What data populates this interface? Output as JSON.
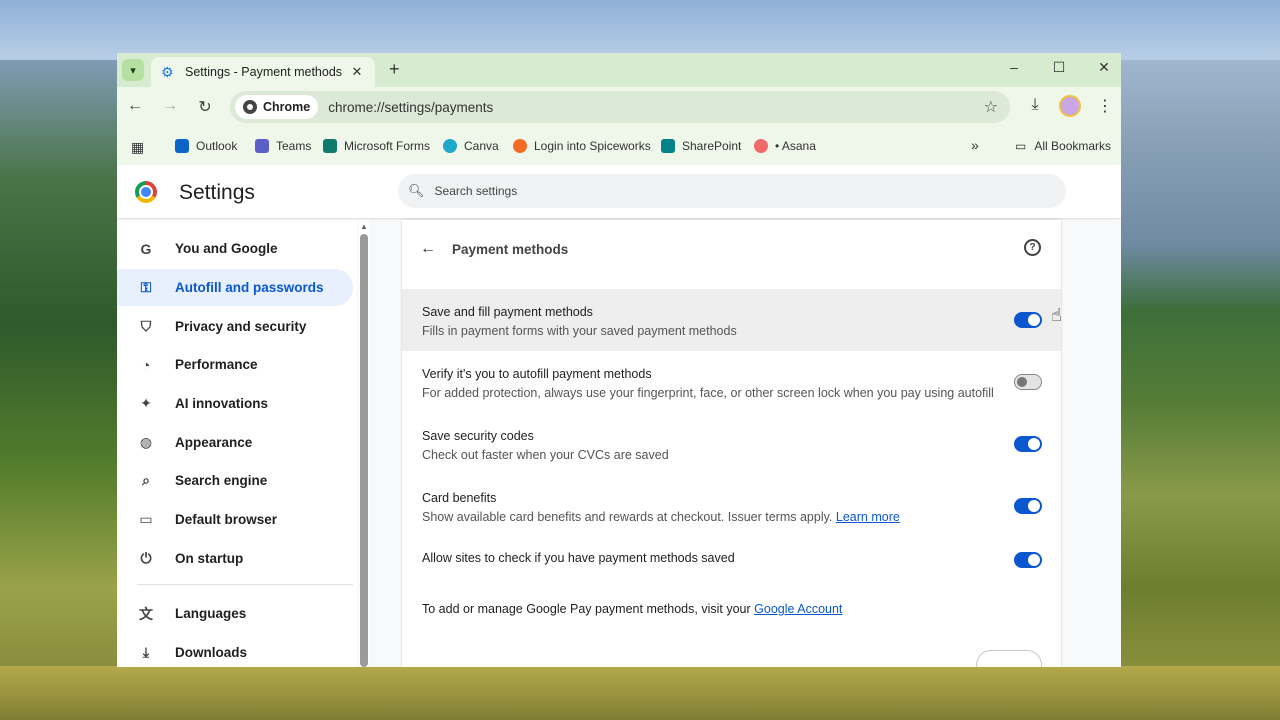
{
  "browser": {
    "tab_title": "Settings - Payment methods",
    "tab_close": "✕",
    "new_tab": "+",
    "minimize": "–",
    "maximize": "☐",
    "close": "✕",
    "chip_label": "Chrome",
    "url": "chrome://settings/payments",
    "bookmarks": [
      "Outlook",
      "Teams",
      "Microsoft Forms",
      "Canva",
      "Login into Spiceworks",
      "SharePoint",
      "• Asana"
    ],
    "all_bookmarks": "All Bookmarks",
    "more": "»"
  },
  "settings": {
    "title": "Settings",
    "search_placeholder": "Search settings",
    "sidebar": [
      {
        "label": "You and Google",
        "icon": "google-icon"
      },
      {
        "label": "Autofill and passwords",
        "icon": "key-icon",
        "active": true
      },
      {
        "label": "Privacy and security",
        "icon": "shield-icon"
      },
      {
        "label": "Performance",
        "icon": "speedometer-icon"
      },
      {
        "label": "AI innovations",
        "icon": "sparkle-icon"
      },
      {
        "label": "Appearance",
        "icon": "palette-icon"
      },
      {
        "label": "Search engine",
        "icon": "search-icon"
      },
      {
        "label": "Default browser",
        "icon": "browser-icon"
      },
      {
        "label": "On startup",
        "icon": "power-icon"
      },
      {
        "label": "Languages",
        "icon": "translate-icon"
      },
      {
        "label": "Downloads",
        "icon": "download-icon"
      }
    ],
    "page_title": "Payment methods",
    "rows": [
      {
        "title": "Save and fill payment methods",
        "subtitle": "Fills in payment forms with your saved payment methods",
        "on": true
      },
      {
        "title": "Verify it's you to autofill payment methods",
        "subtitle": "For added protection, always use your fingerprint, face, or other screen lock when you pay using autofill",
        "on": false
      },
      {
        "title": "Save security codes",
        "subtitle": "Check out faster when your CVCs are saved",
        "on": true
      },
      {
        "title": "Card benefits",
        "subtitle": "Show available card benefits and rewards at checkout. Issuer terms apply.",
        "link": "Learn more",
        "on": true
      },
      {
        "title": "Allow sites to check if you have payment methods saved",
        "on": true
      }
    ],
    "manage_text": "To add or manage Google Pay payment methods, visit your",
    "manage_link": "Google Account"
  },
  "colors": {
    "accent": "#0b57d0",
    "frame": "#d6ebd0",
    "toolbar": "#eef7e9"
  }
}
